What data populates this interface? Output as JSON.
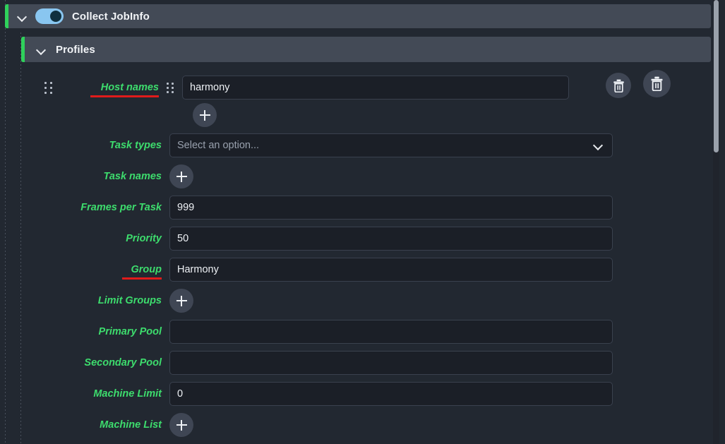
{
  "window": {
    "background_color": "#222831",
    "accent_green": "#2fd15b",
    "label_green": "#3ddc6d",
    "underline_red": "#e01b1b",
    "toggle_on_color": "#89c6f0"
  },
  "sections": {
    "collect_jobinfo": {
      "title": "Collect JobInfo",
      "expanded": true,
      "toggle_on": true,
      "chevron": "chevron-down-icon"
    },
    "profiles": {
      "title": "Profiles",
      "expanded": true,
      "chevron": "chevron-down-icon"
    }
  },
  "form": {
    "rows": [
      {
        "label": "Host names",
        "label_underlined": true,
        "control": "text",
        "value": "harmony",
        "has_drag_handle": true
      },
      {
        "label": "",
        "control": "add-button",
        "button_label": "+"
      },
      {
        "label": "Task types",
        "label_underlined": false,
        "control": "select",
        "value": "",
        "placeholder": "Select an option..."
      },
      {
        "label": "Task names",
        "label_underlined": false,
        "control": "add-button",
        "button_label": "+"
      },
      {
        "label": "Frames per Task",
        "label_underlined": false,
        "control": "text",
        "value": "999"
      },
      {
        "label": "Priority",
        "label_underlined": false,
        "control": "text",
        "value": "50"
      },
      {
        "label": "Group",
        "label_underlined": true,
        "control": "text",
        "value": "Harmony"
      },
      {
        "label": "Limit Groups",
        "label_underlined": false,
        "control": "add-button",
        "button_label": "+"
      },
      {
        "label": "Primary Pool",
        "label_underlined": false,
        "control": "text",
        "value": ""
      },
      {
        "label": "Secondary Pool",
        "label_underlined": false,
        "control": "text",
        "value": ""
      },
      {
        "label": "Machine Limit",
        "label_underlined": false,
        "control": "text",
        "value": "0"
      },
      {
        "label": "Machine List",
        "label_underlined": false,
        "control": "add-button",
        "button_label": "+"
      }
    ]
  },
  "actions": {
    "delete_row_icon": "trash-icon",
    "delete_profile_icon": "trash-icon"
  },
  "scrollbar": {
    "orientation": "vertical",
    "thumb_position_percent": 0
  }
}
